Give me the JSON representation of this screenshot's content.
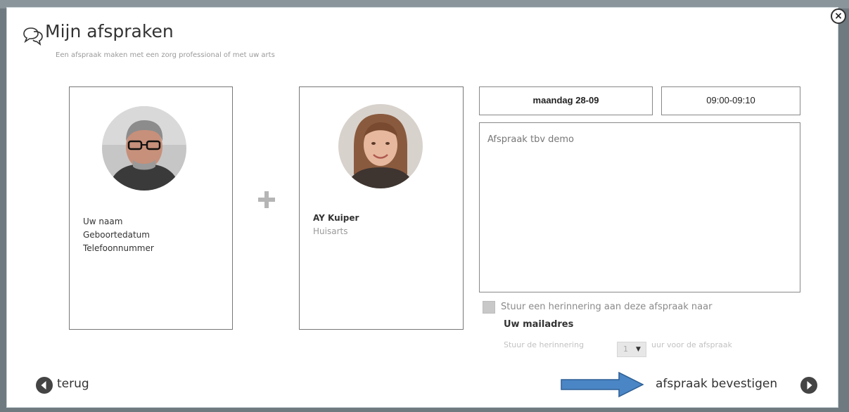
{
  "header": {
    "title": "Mijn afspraken",
    "subtitle": "Een afspraak maken met een zorg professional of met uw arts",
    "icon": "chat-bubbles-icon"
  },
  "close_label": "×",
  "patient": {
    "name": "Uw naam",
    "birthdate": "Geboortedatum",
    "phone": "Telefoonnummer"
  },
  "plus_icon": "plus-icon",
  "doctor": {
    "name": "AY Kuiper",
    "role": "Huisarts"
  },
  "appointment": {
    "date": "maandag 28-09",
    "time": "09:00-09:10",
    "notes": "Afspraak tbv demo"
  },
  "reminder": {
    "label": "Stuur een herinnering aan deze afspraak naar",
    "target": "Uw mailadres",
    "prefix": "Stuur de herinnering",
    "hours": "1",
    "suffix": "uur voor de afspraak"
  },
  "footer": {
    "back_label": "terug",
    "confirm_label": "afspraak bevestigen"
  },
  "colors": {
    "accent_arrow": "#4a86c5",
    "nav_icon": "#444444"
  }
}
